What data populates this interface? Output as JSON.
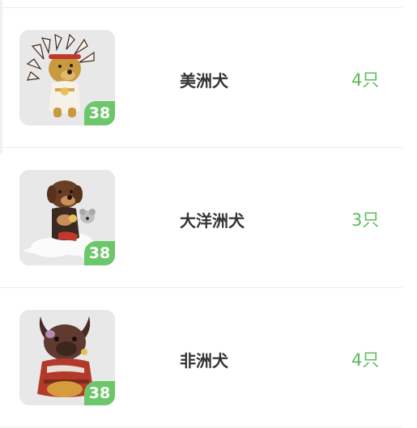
{
  "dogs": [
    {
      "name": "美洲犬",
      "count": "4只",
      "level": "38",
      "icon": "native-headdress-dog-icon"
    },
    {
      "name": "大洋洲犬",
      "count": "3只",
      "level": "38",
      "icon": "cloud-rider-dog-icon"
    },
    {
      "name": "非洲犬",
      "count": "4只",
      "level": "38",
      "icon": "tribal-dog-icon"
    }
  ],
  "colors": {
    "accent": "#6cc66a",
    "count_text": "#5cbb5a",
    "name_text": "#333333",
    "divider": "#ececec"
  }
}
